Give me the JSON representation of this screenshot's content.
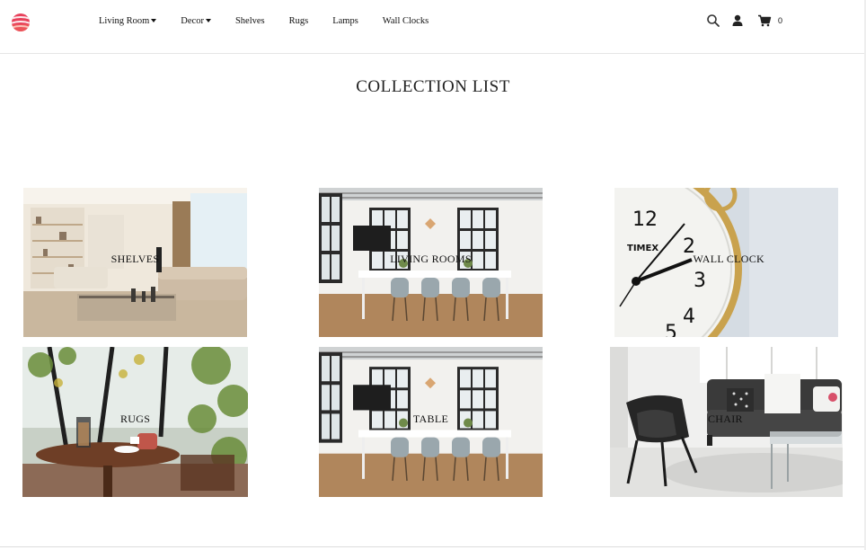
{
  "nav": {
    "logo_icon": "striped-ball-logo",
    "links": [
      {
        "label": "Living Room",
        "dropdown": true
      },
      {
        "label": "Decor",
        "dropdown": true
      },
      {
        "label": "Shelves",
        "dropdown": false
      },
      {
        "label": "Rugs",
        "dropdown": false
      },
      {
        "label": "Lamps",
        "dropdown": false
      },
      {
        "label": "Wall Clocks",
        "dropdown": false
      }
    ],
    "icons": [
      "search-icon",
      "user-icon",
      "cart-icon"
    ],
    "cart_count": "0"
  },
  "page": {
    "title": "COLLECTION LIST"
  },
  "collections": [
    {
      "label": "SHELVES",
      "image": "living-room-photo"
    },
    {
      "label": "LIVING ROOMS",
      "image": "dining-room-photo"
    },
    {
      "label": "WALL CLOCK",
      "image": "alarm-clock-photo"
    },
    {
      "label": "RUGS",
      "image": "cafe-table-photo"
    },
    {
      "label": "TABLE",
      "image": "dining-room-photo"
    },
    {
      "label": "CHAIR",
      "image": "armchair-sofa-photo"
    }
  ],
  "colors": {
    "logo_primary": "#e8405a",
    "logo_secondary": "#f47b5c",
    "text": "#111111"
  }
}
